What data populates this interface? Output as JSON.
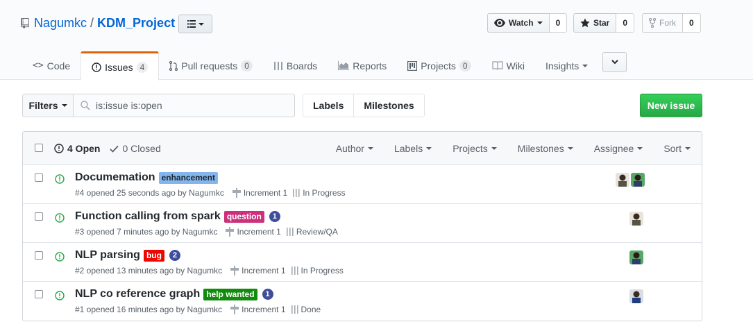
{
  "repo": {
    "owner": "Nagumkc",
    "slash": "/",
    "name": "KDM_Project"
  },
  "social": {
    "watch": {
      "label": "Watch",
      "count": "0"
    },
    "star": {
      "label": "Star",
      "count": "0"
    },
    "fork": {
      "label": "Fork",
      "count": "0"
    }
  },
  "tabs": [
    {
      "label": "Code"
    },
    {
      "label": "Issues",
      "count": "4"
    },
    {
      "label": "Pull requests",
      "count": "0"
    },
    {
      "label": "Boards"
    },
    {
      "label": "Reports"
    },
    {
      "label": "Projects",
      "count": "0"
    },
    {
      "label": "Wiki"
    },
    {
      "label": "Insights"
    }
  ],
  "filters": {
    "button_label": "Filters",
    "search_value": "is:issue is:open",
    "labels_label": "Labels",
    "milestones_label": "Milestones",
    "new_issue_label": "New issue"
  },
  "list_header": {
    "open_label": "4 Open",
    "closed_label": "0 Closed",
    "menus": [
      "Author",
      "Labels",
      "Projects",
      "Milestones",
      "Assignee",
      "Sort"
    ]
  },
  "issues": [
    {
      "title": "Documemation",
      "label": {
        "text": "enhancement",
        "bg": "#84b6eb",
        "fg": "#1c2733"
      },
      "comments": "",
      "meta": "#4 opened 25 seconds ago by Nagumkc",
      "milestone": "Increment 1",
      "project": "In Progress"
    },
    {
      "title": "Function calling from spark",
      "label": {
        "text": "question",
        "bg": "#cc317c",
        "fg": "#ffffff"
      },
      "comments": "1",
      "meta": "#3 opened 7 minutes ago by Nagumkc",
      "milestone": "Increment 1",
      "project": "Review/QA"
    },
    {
      "title": "NLP parsing",
      "label": {
        "text": "bug",
        "bg": "#ee0701",
        "fg": "#ffffff"
      },
      "comments": "2",
      "meta": "#2 opened 13 minutes ago by Nagumkc",
      "milestone": "Increment 1",
      "project": "In Progress"
    },
    {
      "title": "NLP co reference graph",
      "label": {
        "text": "help wanted",
        "bg": "#128a0c",
        "fg": "#ffffff"
      },
      "comments": "1",
      "meta": "#1 opened 16 minutes ago by Nagumkc",
      "milestone": "Increment 1",
      "project": "Done"
    }
  ],
  "colors": {
    "link": "#0366d6",
    "selected_tab_accent": "#e36209",
    "open_issue": "#28a745",
    "new_issue_button": "#2cbe4e"
  }
}
